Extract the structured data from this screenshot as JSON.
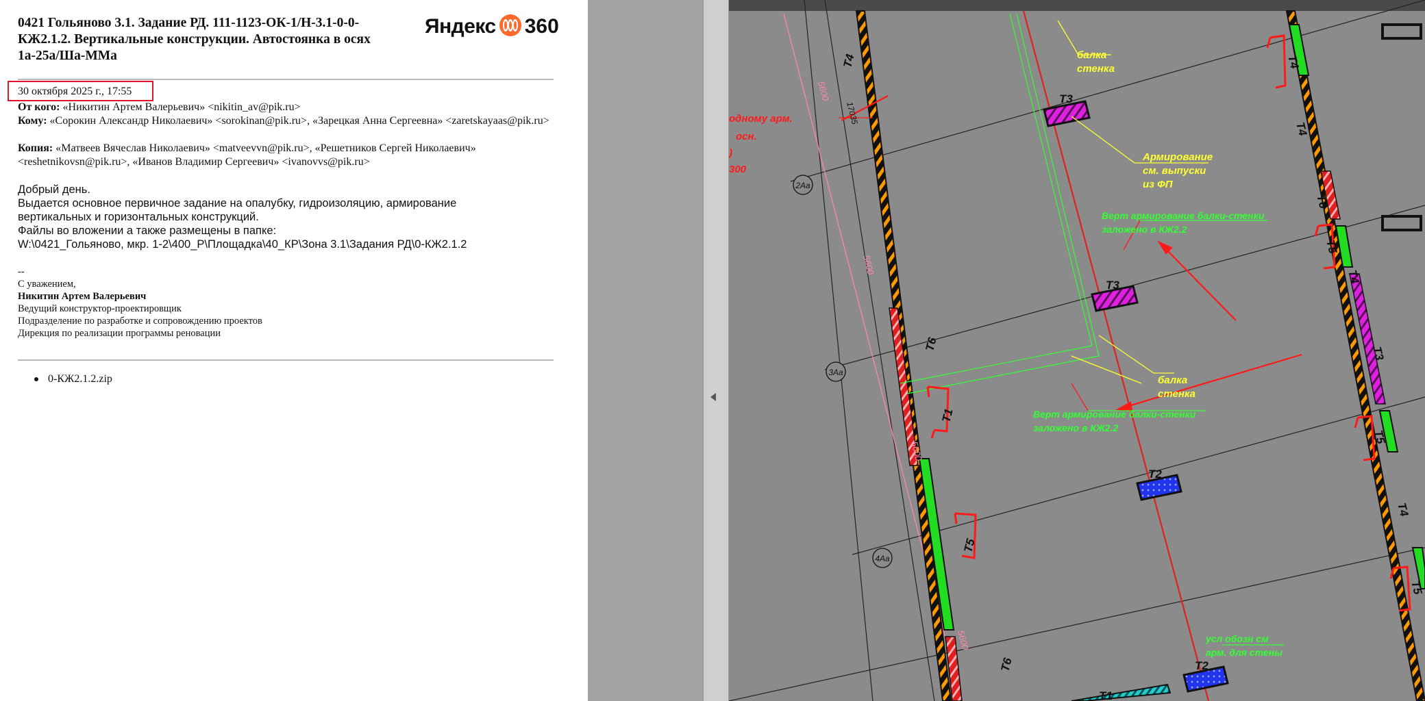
{
  "email": {
    "subject": "0421 Гольяново 3.1. Задание РД. 111-1123-ОК-1/Н-3.1-0-0-КЖ2.1.2. Вертикальные конструкции. Автостоянка в осях 1а-25а/Ша-ММа",
    "logo": {
      "brand": "Яндекс",
      "product": "360"
    },
    "date": "30 октября 2025 г., 17:55",
    "from_label": "От кого:",
    "from_value": "«Никитин Артем Валерьевич» <nikitin_av@pik.ru>",
    "to_label": "Кому:",
    "to_value": "«Сорокин Александр Николаевич» <sorokinan@pik.ru>, «Зарецкая Анна Сергеевна» <zaretskayaas@pik.ru>",
    "cc_label": "Копия:",
    "cc_value": "«Матвеев Вячеслав Николаевич» <matveevvn@pik.ru>, «Решетников Сергей Николаевич» <reshetnikovsn@pik.ru>, «Иванов Владимир Сергеевич» <ivanovvs@pik.ru>",
    "greeting": "Добрый день.",
    "body_line1": "Выдается основное первичное задание на опалубку, гидроизоляцию, армирование",
    "body_line2": "вертикальных и горизонтальных конструкций.",
    "body_line3": "Файлы во вложении а также размещены в папке:",
    "body_line4": "W:\\0421_Гольяново, мкр. 1-2\\400_Р\\Площадка\\40_КР\\Зона 3.1\\Задания РД\\0-КЖ2.1.2",
    "sig_dash": "--",
    "sig_regards": "С уважением,",
    "sig_name": "Никитин Артем Валерьевич",
    "sig_position": "Ведущий конструктор-проектировщик",
    "sig_division": "Подразделение по разработке и сопровождению проектов",
    "sig_directorate": "Дирекция по реализации программы реновации",
    "attachment": "0-КЖ2.1.2.zip"
  },
  "drawing": {
    "labels": {
      "beam_wall_1": "балка стенка",
      "beam_wall_1a": "балка",
      "beam_wall_1b": "стенка",
      "reinf_a": "Армирование",
      "reinf_b": "см. выпуски",
      "reinf_c": "из ФП",
      "vert_reinf_1a": "Верт армирование балки-стенки",
      "vert_reinf_1b": "заложено в КЖ2.2",
      "vert_reinf_2a": "Верт армирование балки-стенки",
      "vert_reinf_2b": "заложено в КЖ2.2",
      "beam_wall_2a": "балка",
      "beam_wall_2b": "стенка",
      "left_note_1": "одному арм.",
      "left_note_2": "осн.",
      "left_note_3": ")",
      "left_note_4": "300",
      "bottom_note_1": "усл обозн см",
      "bottom_note_2": "арм. для стены",
      "dim_5600": "5600",
      "dim_17035": "17035",
      "axis_2": "2Аа",
      "axis_3": "3Аа",
      "axis_4": "4Аа",
      "t1": "Т1",
      "t2": "Т2",
      "t3": "Т3",
      "t4": "Т4",
      "t5": "Т5",
      "t6": "Т6"
    },
    "colors": {
      "background": "#8b8b8b",
      "wall_black": "#111111",
      "hatch_orange": "#ff9900",
      "wall_red": "#e02020",
      "wall_green": "#22dd22",
      "wall_magenta": "#e020e0",
      "wall_blue": "#2233ee",
      "annot_yellow": "#ffff33",
      "annot_green": "#33ff33",
      "annot_red": "#ff1a1a",
      "dim_pink": "#ff88aa"
    }
  }
}
